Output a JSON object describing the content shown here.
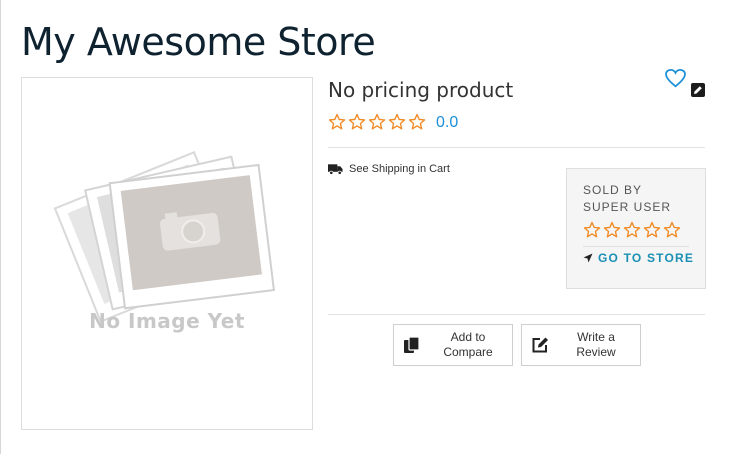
{
  "store": {
    "title": "My Awesome Store"
  },
  "image": {
    "placeholder_text": "No Image Yet"
  },
  "product": {
    "title": "No pricing product",
    "rating_value": "0.0",
    "shipping_text": "See Shipping in Cart"
  },
  "seller": {
    "label": "SOLD BY",
    "name": "SUPER USER",
    "store_link": "GO TO STORE"
  },
  "actions": {
    "compare_label": "Add to Compare",
    "review_label": "Write a Review"
  },
  "icons": {
    "wishlist": "heart-outline-icon",
    "edit": "edit-pencil-icon",
    "rating_star": "star-outline-icon",
    "shipping": "truck-icon",
    "store_link": "location-arrow-icon",
    "compare": "copy-icon",
    "review": "pencil-square-icon"
  },
  "colors": {
    "title": "#0f2230",
    "rating_value": "#1a8fd8",
    "star": "#f08a24",
    "wishlist": "#1a8fd8",
    "store_link": "#1a8fb4",
    "seller_box": "#f5f5f5"
  }
}
